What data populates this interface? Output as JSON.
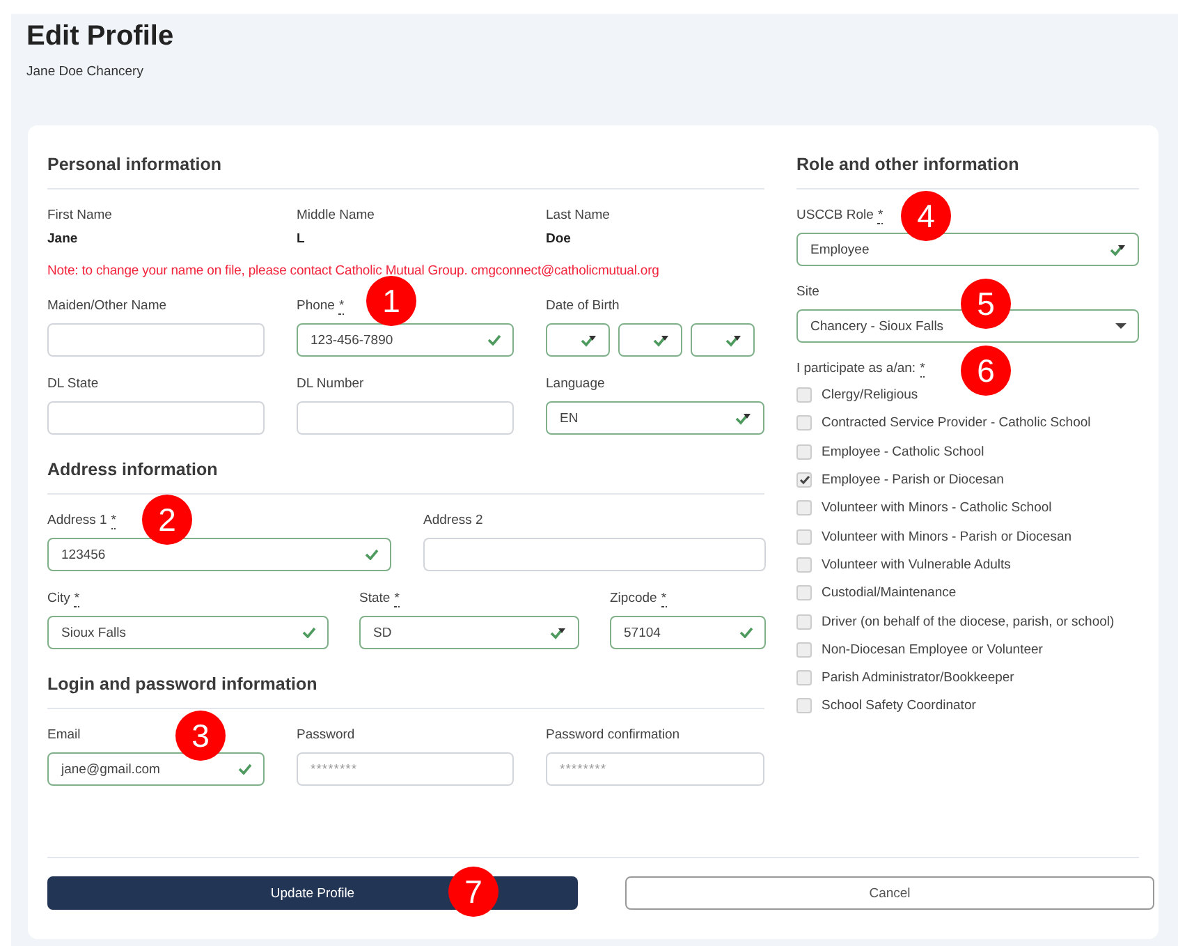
{
  "page": {
    "title": "Edit Profile",
    "subtitle": "Jane Doe Chancery"
  },
  "personal": {
    "heading": "Personal information",
    "names": [
      {
        "label": "First Name",
        "value": "Jane"
      },
      {
        "label": "Middle Name",
        "value": "L"
      },
      {
        "label": "Last Name",
        "value": "Doe"
      }
    ],
    "note": "Note: to change your name on file, please contact Catholic Mutual Group. cmgconnect@catholicmutual.org",
    "rows": [
      [
        {
          "label": "Maiden/Other Name",
          "kind": "text",
          "valid": false
        },
        {
          "label": "Phone",
          "mark": "*",
          "kind": "text",
          "value": "123-456-7890",
          "valid": true,
          "callout": "1"
        },
        {
          "label": "Date of Birth",
          "kind": "date",
          "parts": [
            {
              "valid": true
            },
            {
              "valid": true
            },
            {
              "valid": true
            }
          ]
        }
      ],
      [
        {
          "label": "DL State",
          "kind": "text",
          "valid": false
        },
        {
          "label": "DL Number",
          "kind": "text",
          "valid": false
        },
        {
          "label": "Language",
          "kind": "select",
          "value": "EN",
          "valid": true
        }
      ]
    ]
  },
  "address": {
    "heading": "Address information",
    "rows": [
      [
        {
          "label": "Address 1",
          "mark": "*",
          "kind": "text",
          "value": "123456",
          "valid": true,
          "callout": "2"
        },
        {
          "label": "Address 2",
          "kind": "text",
          "valid": false
        }
      ],
      [
        {
          "label": "City",
          "mark": "*",
          "kind": "text",
          "value": "Sioux Falls",
          "valid": true
        },
        {
          "label": "State",
          "mark": "*",
          "kind": "select",
          "value": "SD",
          "valid": true
        },
        {
          "label": "Zipcode",
          "mark": "*",
          "kind": "text",
          "value": "57104",
          "valid": true
        }
      ]
    ]
  },
  "login": {
    "heading": "Login and password information",
    "rows": [
      [
        {
          "label": "Email",
          "kind": "text",
          "value": "jane@gmail.com",
          "valid": true,
          "callout": "3"
        },
        {
          "label": "Password",
          "kind": "text",
          "placeholder": "********",
          "valid": false
        },
        {
          "label": "Password confirmation",
          "kind": "text",
          "placeholder": "********",
          "valid": false
        }
      ]
    ]
  },
  "role": {
    "heading": "Role and other information",
    "fields": [
      {
        "label": "USCCB Role",
        "mark": "*",
        "kind": "select",
        "value": "Employee",
        "valid": true,
        "callout": "4"
      },
      {
        "label": "Site",
        "kind": "dropdown",
        "value": "Chancery - Sioux Falls",
        "valid": true,
        "callout": "5"
      }
    ],
    "participate": {
      "label": "I participate as a/an:",
      "mark": "*",
      "callout": "6"
    },
    "options": [
      {
        "label": "Clergy/Religious",
        "checked": false
      },
      {
        "label": "Contracted Service Provider - Catholic School",
        "checked": false
      },
      {
        "label": "Employee - Catholic School",
        "checked": false
      },
      {
        "label": "Employee - Parish or Diocesan",
        "checked": true
      },
      {
        "label": "Volunteer with Minors - Catholic School",
        "checked": false
      },
      {
        "label": "Volunteer with Minors - Parish or Diocesan",
        "checked": false
      },
      {
        "label": "Volunteer with Vulnerable Adults",
        "checked": false
      },
      {
        "label": "Custodial/Maintenance",
        "checked": false
      },
      {
        "label": "Driver (on behalf of the diocese, parish, or school)",
        "checked": false
      },
      {
        "label": "Non-Diocesan Employee or Volunteer",
        "checked": false
      },
      {
        "label": "Parish Administrator/Bookkeeper",
        "checked": false
      },
      {
        "label": "School Safety Coordinator",
        "checked": false
      }
    ]
  },
  "buttons": [
    {
      "label": "Update Profile",
      "kind": "primary",
      "callout": "7"
    },
    {
      "label": "Cancel",
      "kind": "secondary"
    }
  ]
}
